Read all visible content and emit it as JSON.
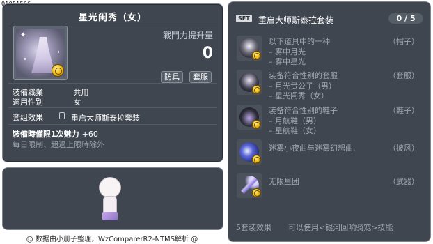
{
  "item_id": "01051566",
  "item": {
    "name": "星光闺秀（女）",
    "power_label": "戰鬥力提升量",
    "power_value": "0",
    "tags": [
      "防具",
      "套服"
    ],
    "stats": [
      {
        "key": "裝備職業",
        "value": "共用"
      },
      {
        "key": "適用性别",
        "value": "女"
      }
    ],
    "set_effect_label": "套组效果",
    "set_effect_value": "重启大师斯泰拉套装",
    "limit_label": "裝備時僅限1次魅力",
    "limit_bonus": "+60",
    "limit_note": "每日限制、超過上限時除外",
    "icons": {
      "item": "dress-icon",
      "coin": "coin-icon"
    }
  },
  "credit": "@ 数据由小册子整理，WzComparerR2-NTMS解析 @",
  "set": {
    "badge": "SET",
    "name": "重启大师斯泰拉套装",
    "count": "0 / 5",
    "items": [
      {
        "title": "以下道具中的一种",
        "category": "（帽子）",
        "options": [
          "– 雾中月光",
          "– 雾中星光"
        ],
        "icon": "hat-icon"
      },
      {
        "title": "装备符合性别的套服",
        "category": "（套服）",
        "options": [
          "– 月光贵公子（男）",
          "– 星光闺秀（女）"
        ],
        "icon": "outfit-icon"
      },
      {
        "title": "装备符合性别的鞋子",
        "category": "（鞋子）",
        "options": [
          "– 月航鞋（男）",
          "– 星航鞋（女）"
        ],
        "icon": "shoes-icon"
      },
      {
        "title": "迷雾小夜曲与迷雾幻想曲.",
        "category": "（披风）",
        "options": [],
        "icon": "cape-icon"
      },
      {
        "title": "无限星团",
        "category": "（武器）",
        "options": [],
        "icon": "wand-icon"
      }
    ],
    "footer_label": "5套装效果",
    "footer_text": "可以使用<银河回响骑宠>技能"
  },
  "colors": {
    "panel_bg": "#3f4650",
    "panel_border": "#7d838b",
    "dim_text": "#a2a7ae",
    "coin": "#f2c21a"
  }
}
